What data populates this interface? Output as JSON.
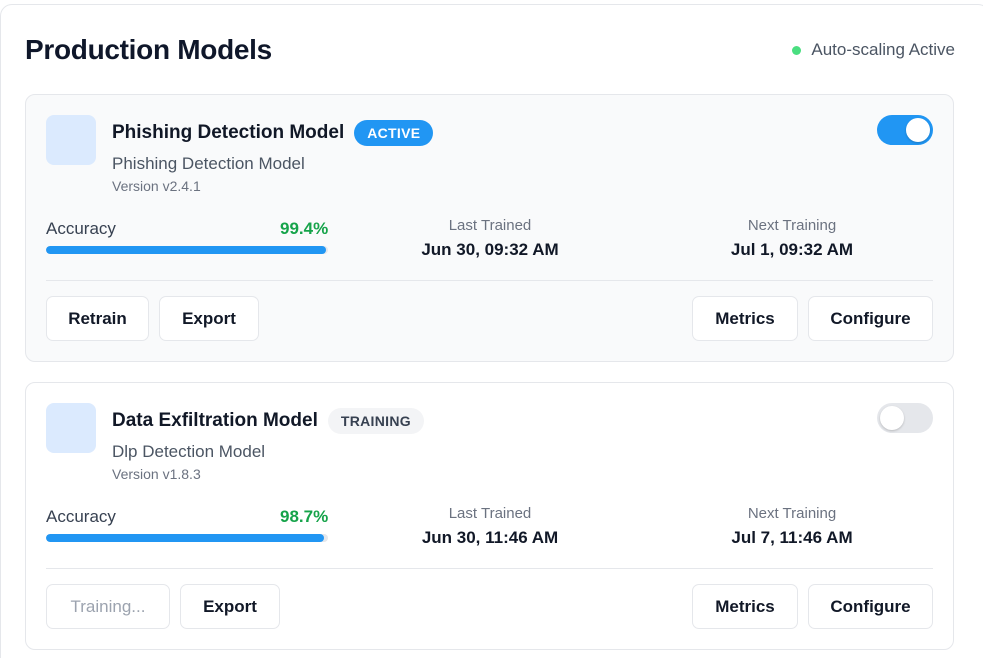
{
  "header": {
    "title": "Production Models",
    "status_text": "Auto-scaling Active",
    "status_color": "#4ade80"
  },
  "models": [
    {
      "name": "Phishing Detection Model",
      "badge": "ACTIVE",
      "type": "Phishing Detection Model",
      "version": "Version v2.4.1",
      "enabled": true,
      "accuracy_label": "Accuracy",
      "accuracy": "99.4%",
      "accuracy_fraction": 0.994,
      "last_trained_label": "Last Trained",
      "last_trained": "Jun 30, 09:32 AM",
      "next_training_label": "Next Training",
      "next_training": "Jul 1, 09:32 AM",
      "buttons": {
        "retrain": "Retrain",
        "export": "Export",
        "metrics": "Metrics",
        "configure": "Configure"
      }
    },
    {
      "name": "Data Exfiltration Model",
      "badge": "TRAINING",
      "type": "Dlp Detection Model",
      "version": "Version v1.8.3",
      "enabled": false,
      "accuracy_label": "Accuracy",
      "accuracy": "98.7%",
      "accuracy_fraction": 0.987,
      "last_trained_label": "Last Trained",
      "last_trained": "Jun 30, 11:46 AM",
      "next_training_label": "Next Training",
      "next_training": "Jul 7, 11:46 AM",
      "buttons": {
        "retrain": "Training...",
        "export": "Export",
        "metrics": "Metrics",
        "configure": "Configure"
      }
    }
  ],
  "colors": {
    "accent": "#2196f3",
    "success": "#16a34a"
  }
}
